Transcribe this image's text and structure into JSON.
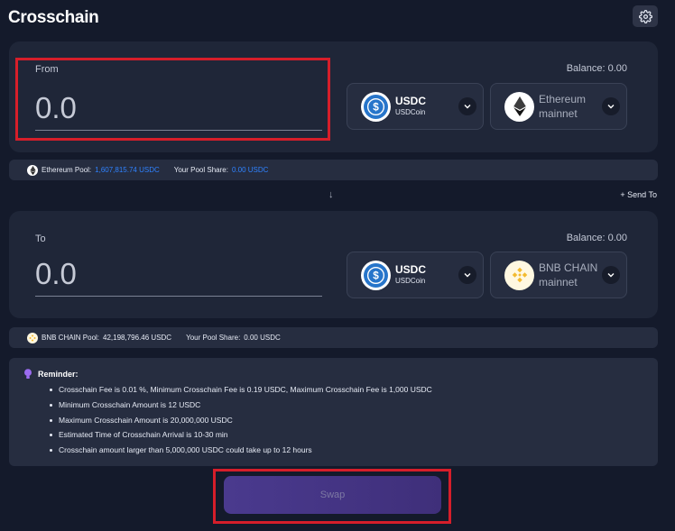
{
  "header": {
    "title": "Crosschain",
    "settings_icon": "gear-icon"
  },
  "from": {
    "label": "From",
    "balance": "Balance: 0.00",
    "amount_placeholder": "0.0",
    "token": {
      "symbol": "USDC",
      "name": "USDCoin",
      "icon": "usdc-icon"
    },
    "chain": {
      "name": "Ethereum mainnet",
      "icon": "ethereum-icon"
    }
  },
  "from_pool": {
    "pool_label": "Ethereum Pool:",
    "pool_value": "1,607,815.74 USDC",
    "share_label": "Your Pool Share:",
    "share_value": "0.00 USDC"
  },
  "send_to": "Send To",
  "to": {
    "label": "To",
    "balance": "Balance: 0.00",
    "amount_placeholder": "0.0",
    "token": {
      "symbol": "USDC",
      "name": "USDCoin",
      "icon": "usdc-icon"
    },
    "chain": {
      "name": "BNB CHAIN mainnet",
      "icon": "bnb-icon"
    }
  },
  "to_pool": {
    "pool_label": "BNB CHAIN Pool:",
    "pool_value": "42,198,796.46 USDC",
    "share_label": "Your Pool Share:",
    "share_value": "0.00 USDC"
  },
  "reminder": {
    "title": "Reminder:",
    "items": [
      "Crosschain Fee is 0.01 %, Minimum Crosschain Fee is 0.19 USDC, Maximum Crosschain Fee is 1,000 USDC",
      "Minimum Crosschain Amount is 12 USDC",
      "Maximum Crosschain Amount is 20,000,000 USDC",
      "Estimated Time of Crosschain Arrival is 10-30 min",
      "Crosschain amount larger than 5,000,000 USDC could take up to 12 hours"
    ]
  },
  "swap_label": "Swap",
  "colors": {
    "highlight": "#d61e2a",
    "accent": "#2f82ff",
    "swap": "#4a3a8e"
  }
}
